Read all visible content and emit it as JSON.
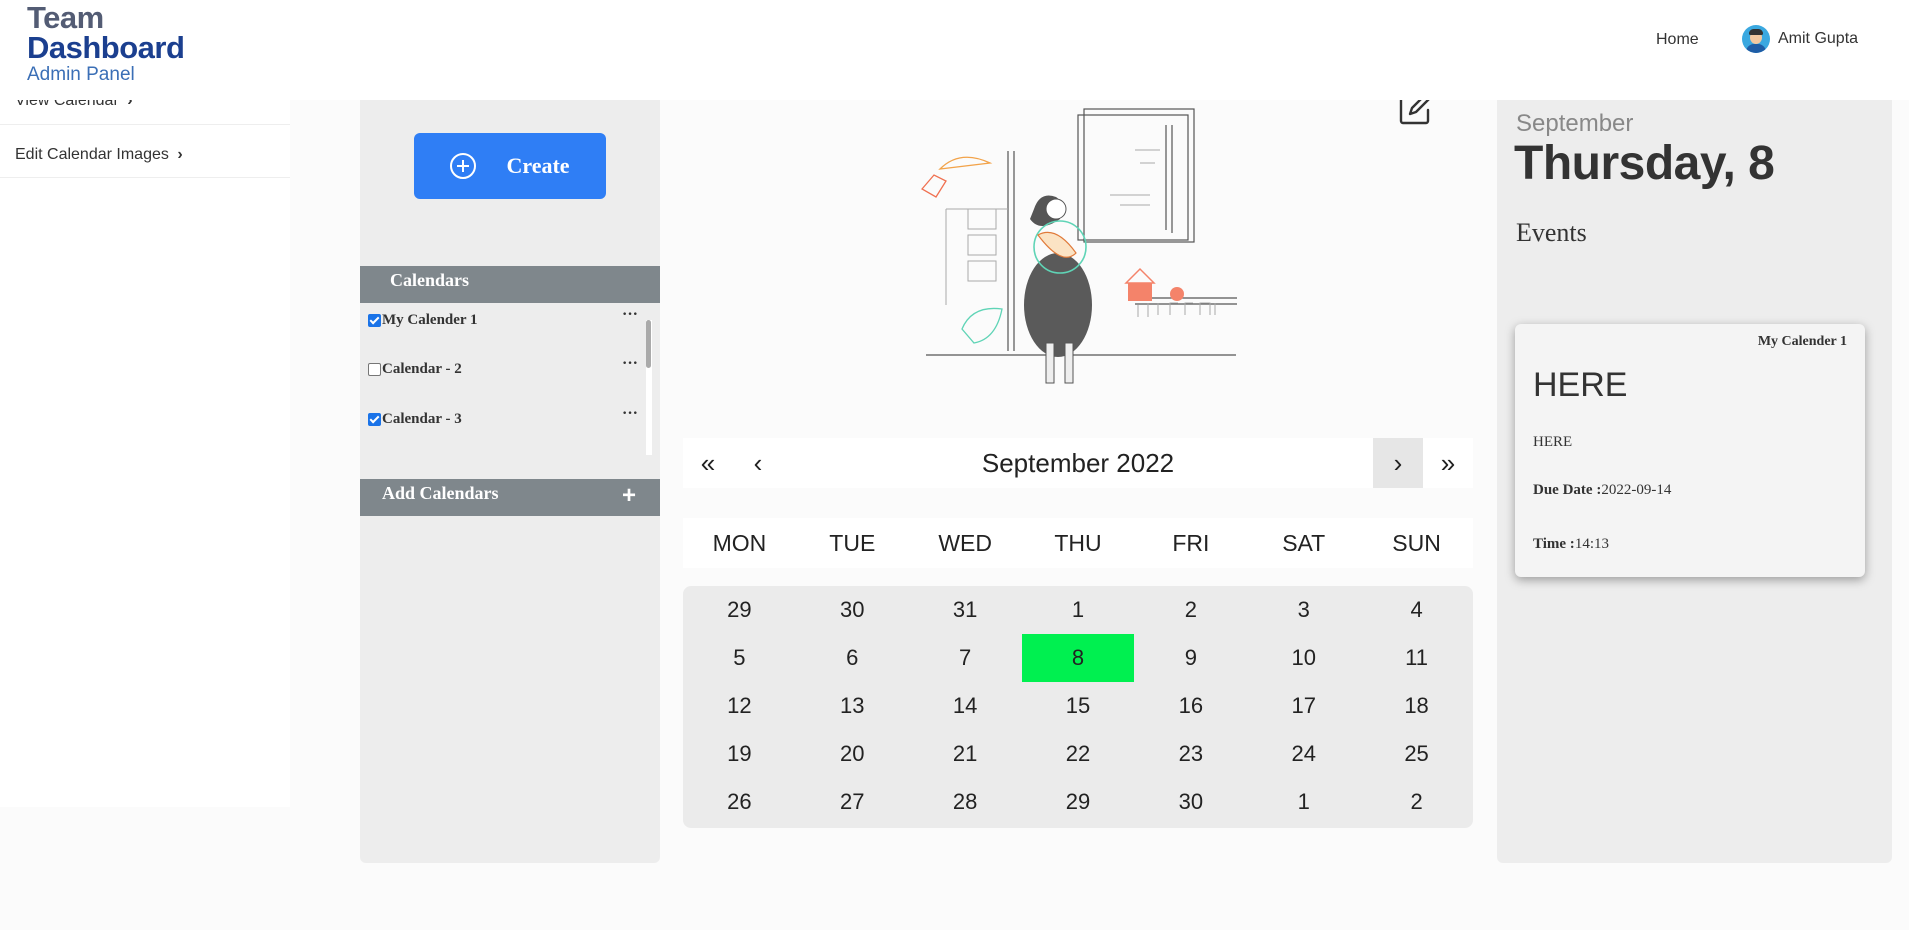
{
  "brand": {
    "line1": "Team",
    "line2": "Dashboard",
    "line3": "Admin Panel"
  },
  "topnav": {
    "home": "Home",
    "user_name": "Amit Gupta"
  },
  "sidebar": {
    "items": [
      {
        "label": "View Calendar",
        "chevron": "›"
      },
      {
        "label": "Edit Calendar Images",
        "chevron": "›"
      }
    ]
  },
  "left_panel": {
    "create_label": "Create",
    "calendars_header": "Calendars",
    "calendars": [
      {
        "label": "My Calender 1",
        "checked": true
      },
      {
        "label": "Calendar - 2",
        "checked": false
      },
      {
        "label": "Calendar - 3",
        "checked": true
      }
    ],
    "more_glyph": "···",
    "add_calendars_label": "Add Calendars",
    "add_glyph": "+"
  },
  "calendar": {
    "month_label": "September 2022",
    "nav": {
      "prev_year": "«",
      "prev_month": "‹",
      "next_month": "›",
      "next_year": "»"
    },
    "weekdays": [
      "MON",
      "TUE",
      "WED",
      "THU",
      "FRI",
      "SAT",
      "SUN"
    ],
    "weeks": [
      [
        "29",
        "30",
        "31",
        "1",
        "2",
        "3",
        "4"
      ],
      [
        "5",
        "6",
        "7",
        "8",
        "9",
        "10",
        "11"
      ],
      [
        "12",
        "13",
        "14",
        "15",
        "16",
        "17",
        "18"
      ],
      [
        "19",
        "20",
        "21",
        "22",
        "23",
        "24",
        "25"
      ],
      [
        "26",
        "27",
        "28",
        "29",
        "30",
        "1",
        "2"
      ]
    ],
    "today": "8",
    "today_color": "#00f050"
  },
  "right_panel": {
    "month": "September",
    "day_label": "Thursday, 8",
    "events_header": "Events",
    "event": {
      "calendar": "My Calender 1",
      "title": "HERE",
      "description": "HERE",
      "due_key": "Due Date :",
      "due_value": "2022-09-14",
      "time_key": "Time :",
      "time_value": "14:13"
    }
  },
  "colors": {
    "accent": "#2f7ef5",
    "panel_header": "#7f878c",
    "today": "#00f050",
    "brand_dark": "#1b3f8f"
  }
}
